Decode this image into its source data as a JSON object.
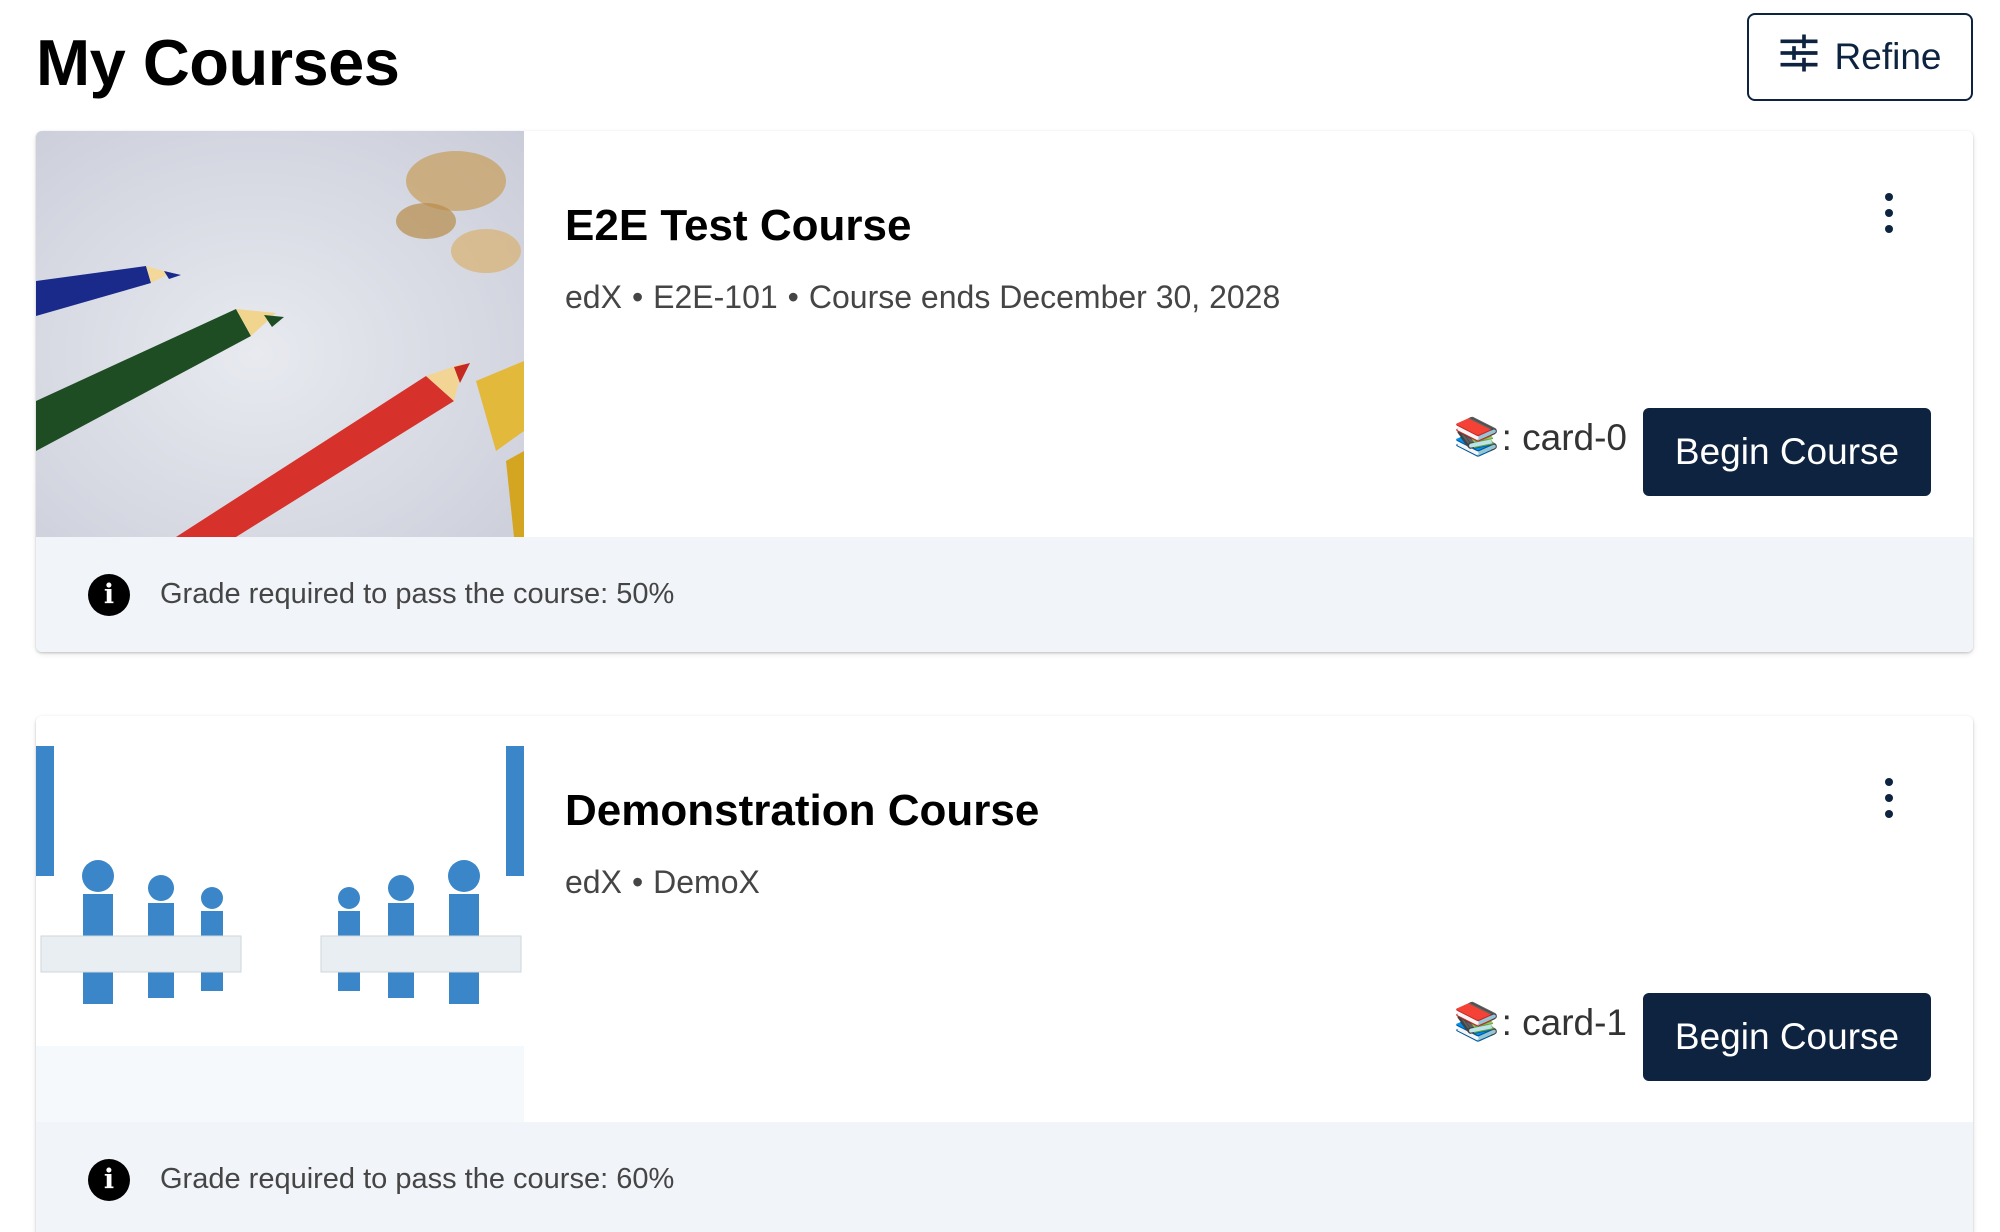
{
  "page": {
    "title": "My Courses"
  },
  "toolbar": {
    "refine_label": "Refine"
  },
  "courses": [
    {
      "title": "E2E Test Course",
      "org": "edX",
      "number": "E2E-101",
      "end": "Course ends December 30, 2028",
      "card_id_label": ": card-0",
      "action_label": "Begin Course",
      "footer": "Grade required to pass the course: 50%",
      "image": "colored-pencils"
    },
    {
      "title": "Demonstration Course",
      "org": "edX",
      "number": "DemoX",
      "end": "",
      "card_id_label": ": card-1",
      "action_label": "Begin Course",
      "footer": "Grade required to pass the course: 60%",
      "image": "puzzle-people"
    }
  ],
  "icons": {
    "refine": "sliders-icon",
    "menu": "kebab-menu-icon",
    "info": "info-icon",
    "books": "books-emoji-icon"
  },
  "colors": {
    "primary": "#0d2340",
    "footer_bg": "#f1f5f9",
    "text_muted": "#454545"
  }
}
